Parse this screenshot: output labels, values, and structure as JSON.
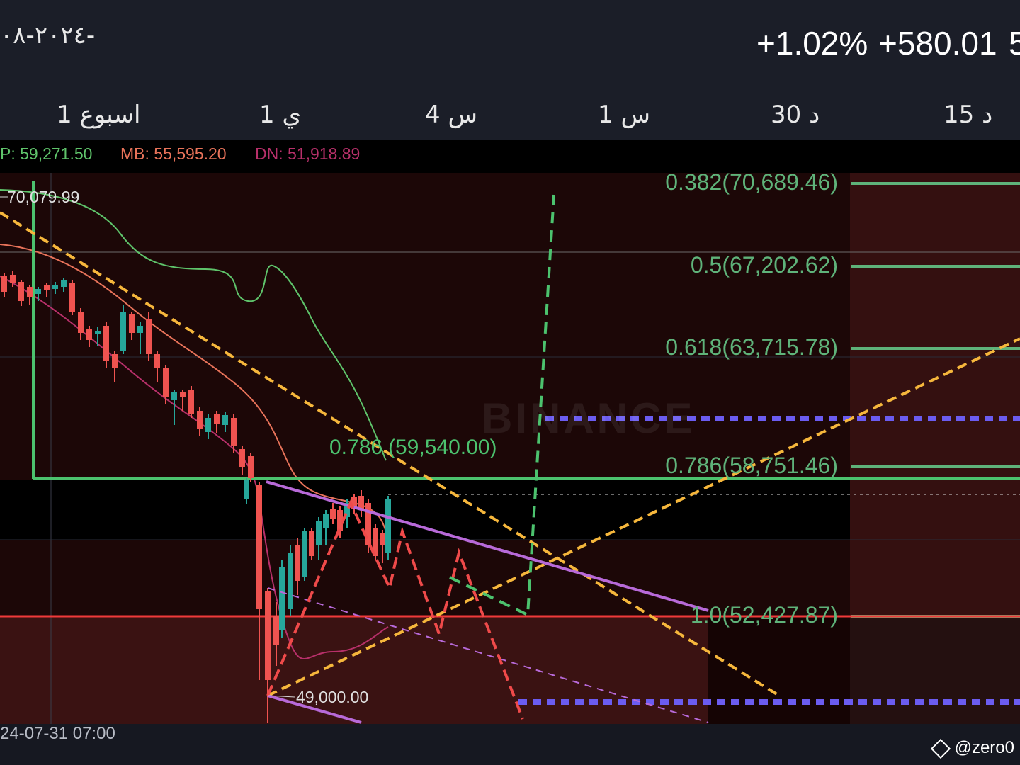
{
  "header": {
    "date": "٢٠٢٤-٠٨-",
    "change_percent": "+1.02%",
    "change_value": "+580.01",
    "price_clip": "5"
  },
  "timeframes": [
    {
      "label": "1 اسبوع"
    },
    {
      "label": "1 ي"
    },
    {
      "label": "4 س"
    },
    {
      "label": "1 س"
    },
    {
      "label": "30 د"
    },
    {
      "label": "15 د"
    }
  ],
  "bollinger": {
    "up_label": "P: 59,271.50",
    "mb_label": "MB: 55,595.20",
    "dn_label": "DN: 51,918.89",
    "up_color": "#5fc46b",
    "mb_color": "#e8735a",
    "dn_color": "#b8306a"
  },
  "chart_data": {
    "type": "candlestick",
    "high_marker": "70,079.99",
    "low_marker": "49,000.00",
    "fib_center_label": "(59,540.00)",
    "fib_center_overlap": "0.786",
    "fib_levels": [
      {
        "label": "0.382(70,689.46)",
        "ratio": 0.382,
        "price": 70689.46
      },
      {
        "label": "0.5(67,202.62)",
        "ratio": 0.5,
        "price": 67202.62
      },
      {
        "label": "0.618(63,715.78)",
        "ratio": 0.618,
        "price": 63715.78
      },
      {
        "label": "0.786(58,751.46)",
        "ratio": 0.786,
        "price": 58751.46
      },
      {
        "label": "1.0(52,427.87)",
        "ratio": 1.0,
        "price": 52427.87
      }
    ],
    "bottom_date": "24-07-31 07:00",
    "colors": {
      "up": "#26a69a",
      "down": "#ef5350",
      "fib": "#5fb37a",
      "trend": "#f6b73c",
      "channel": "#b86ad9",
      "zigzag": "#ef4a4a",
      "level": "#6b5cf0"
    }
  },
  "watermark": "BINANCE",
  "credit": "@zero0"
}
